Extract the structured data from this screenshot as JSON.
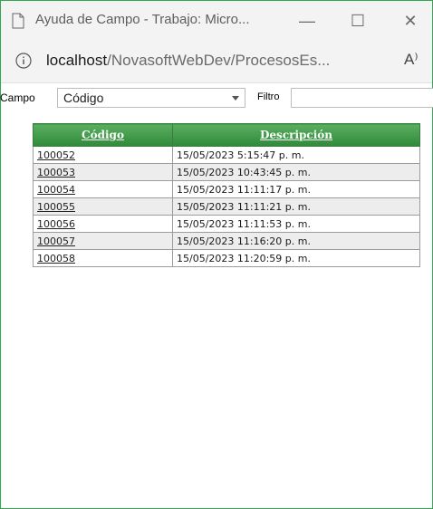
{
  "window": {
    "title": "Ayuda de Campo - Trabajo: Micro...",
    "minimize_glyph": "—",
    "maximize_glyph": "☐",
    "close_glyph": "✕"
  },
  "address": {
    "host": "localhost",
    "path": "/NovasoftWebDev/ProcesosEs...",
    "read_aloud_glyph": "A⁾"
  },
  "filter": {
    "campo_label": "Campo",
    "campo_value": "Código",
    "filtro_label": "Filtro",
    "filtro_value": ""
  },
  "table": {
    "headers": [
      "Código",
      "Descripción"
    ],
    "rows": [
      [
        "100052",
        "15/05/2023 5:15:47 p. m."
      ],
      [
        "100053",
        "15/05/2023 10:43:45 p. m."
      ],
      [
        "100054",
        "15/05/2023 11:11:17 p. m."
      ],
      [
        "100055",
        "15/05/2023 11:11:21 p. m."
      ],
      [
        "100056",
        "15/05/2023 11:11:53 p. m."
      ],
      [
        "100057",
        "15/05/2023 11:16:20 p. m."
      ],
      [
        "100058",
        "15/05/2023 11:20:59 p. m."
      ]
    ]
  },
  "colors": {
    "header_green": "#3c9a44",
    "frame_green": "#2fa84f"
  }
}
